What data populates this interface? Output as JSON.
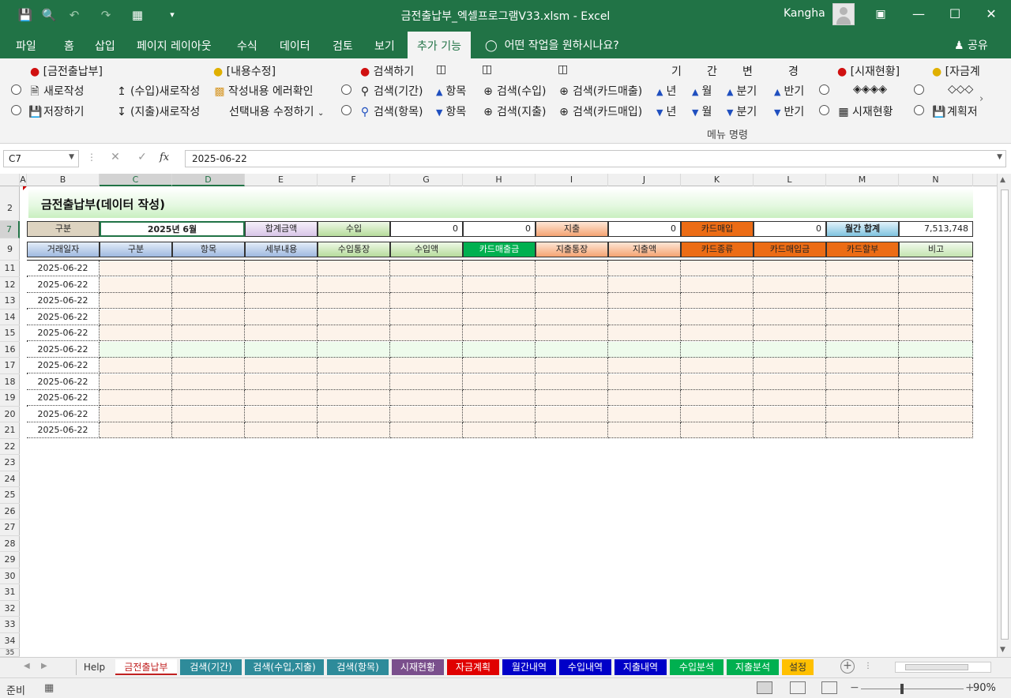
{
  "titlebar": {
    "title": "금전출납부_엑셀프로그램V33.xlsm  -  Excel",
    "user": "Kangha"
  },
  "menu_tabs": [
    "파일",
    "홈",
    "삽입",
    "페이지 레이아웃",
    "수식",
    "데이터",
    "검토",
    "보기",
    "추가 기능"
  ],
  "active_tab": "추가 기능",
  "tell_me": "어떤 작업을 원하시나요?",
  "share": "공유",
  "ribbon": {
    "group1_title": "[금전출납부]",
    "new_entry": "새로작성",
    "save": "저장하기",
    "income_new": "(수입)새로작성",
    "expense_new": "(지출)새로작성",
    "group2_title": "[내용수정]",
    "check_errors": "작성내용 에러확인",
    "edit_selected": "선택내용 수정하기",
    "group3_title": "검색하기",
    "search_period": "검색(기간)",
    "search_item": "검색(항목)",
    "item_up": "항목",
    "item_down": "항목",
    "search_income": "검색(수입)",
    "search_expense": "검색(지출)",
    "search_card_sales": "검색(카드매출)",
    "search_card_purchase": "검색(카드매입)",
    "period_labels": [
      "기",
      "간",
      "변",
      "경"
    ],
    "year": "년",
    "month": "월",
    "quarter": "분기",
    "half": "반기",
    "group4_title": "[시재현황]",
    "diamonds": "◈◈◈◈",
    "cash_status": "시재현황",
    "group5_title": "[자금계",
    "diamonds2": "◇◇◇",
    "plan": "계획저",
    "caption": "메뉴 명령"
  },
  "formula_bar": {
    "name_box": "C7",
    "formula": "2025-06-22"
  },
  "columns": [
    "A",
    "B",
    "C",
    "D",
    "E",
    "F",
    "G",
    "H",
    "I",
    "J",
    "K",
    "L",
    "M",
    "N"
  ],
  "row_numbers": [
    "2",
    "7",
    "9",
    "11",
    "12",
    "13",
    "14",
    "15",
    "16",
    "17",
    "18",
    "19",
    "20",
    "21",
    "22",
    "23",
    "24",
    "25",
    "26",
    "27",
    "28",
    "29",
    "30",
    "31",
    "32",
    "33",
    "34",
    "35"
  ],
  "sheet": {
    "banner_title": "금전출납부(데이터 작성)",
    "summary": {
      "category_label": "구분",
      "period_value": "2025년 6월",
      "total_label": "합계금액",
      "income_label": "수입",
      "income_value1": "0",
      "income_value2": "0",
      "expense_label": "지출",
      "expense_value": "0",
      "card_purchase_label": "카드매입",
      "card_purchase_value": "0",
      "monthly_total_label": "월간 합계",
      "monthly_total_value": "7,513,748"
    },
    "headers": [
      "거래일자",
      "구분",
      "항목",
      "세부내용",
      "수입통장",
      "수입액",
      "카드매출금",
      "지출통장",
      "지출액",
      "카드종류",
      "카드매입금",
      "카드할부",
      "비고"
    ],
    "data_dates": [
      "2025-06-22",
      "2025-06-22",
      "2025-06-22",
      "2025-06-22",
      "2025-06-22",
      "2025-06-22",
      "2025-06-22",
      "2025-06-22",
      "2025-06-22",
      "2025-06-22",
      "2025-06-22"
    ]
  },
  "sheet_tabs": [
    "Help",
    "금전출납부",
    "검색(기간)",
    "검색(수입,지출)",
    "검색(항목)",
    "시재현황",
    "자금계획",
    "월간내역",
    "수입내역",
    "지출내역",
    "수입분석",
    "지출분석",
    "설정"
  ],
  "sheet_tab_colors": [
    "#f0f0f0",
    "#ffffff",
    "#2e8b9a",
    "#2e8b9a",
    "#2e8b9a",
    "#7a4f8c",
    "#e00000",
    "#0000c8",
    "#0000c8",
    "#0000c8",
    "#00b050",
    "#00b050",
    "#ffc000"
  ],
  "status": {
    "ready": "준비",
    "zoom": "90%"
  }
}
